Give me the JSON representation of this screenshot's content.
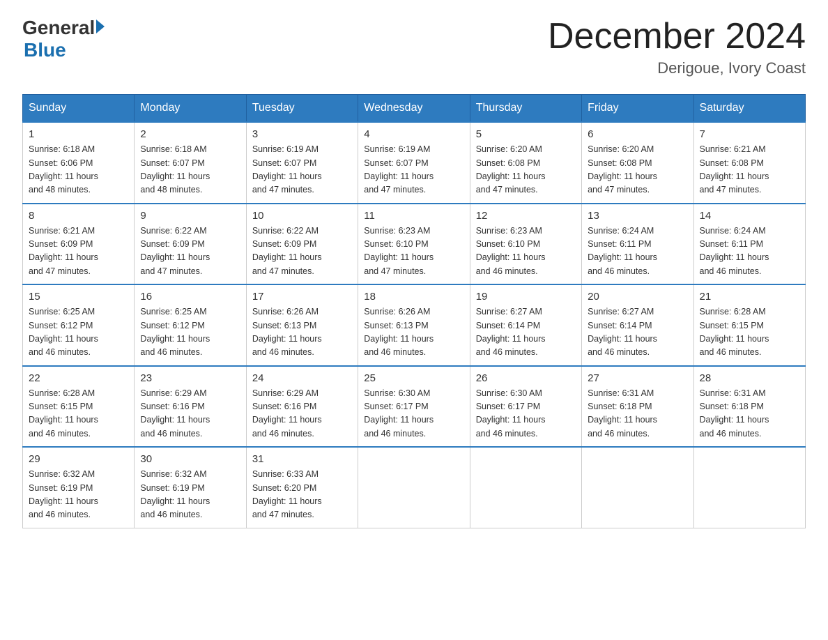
{
  "logo": {
    "general": "General",
    "blue": "Blue"
  },
  "header": {
    "title": "December 2024",
    "location": "Derigoue, Ivory Coast"
  },
  "weekdays": [
    "Sunday",
    "Monday",
    "Tuesday",
    "Wednesday",
    "Thursday",
    "Friday",
    "Saturday"
  ],
  "weeks": [
    [
      {
        "day": "1",
        "sunrise": "6:18 AM",
        "sunset": "6:06 PM",
        "daylight": "11 hours and 48 minutes."
      },
      {
        "day": "2",
        "sunrise": "6:18 AM",
        "sunset": "6:07 PM",
        "daylight": "11 hours and 48 minutes."
      },
      {
        "day": "3",
        "sunrise": "6:19 AM",
        "sunset": "6:07 PM",
        "daylight": "11 hours and 47 minutes."
      },
      {
        "day": "4",
        "sunrise": "6:19 AM",
        "sunset": "6:07 PM",
        "daylight": "11 hours and 47 minutes."
      },
      {
        "day": "5",
        "sunrise": "6:20 AM",
        "sunset": "6:08 PM",
        "daylight": "11 hours and 47 minutes."
      },
      {
        "day": "6",
        "sunrise": "6:20 AM",
        "sunset": "6:08 PM",
        "daylight": "11 hours and 47 minutes."
      },
      {
        "day": "7",
        "sunrise": "6:21 AM",
        "sunset": "6:08 PM",
        "daylight": "11 hours and 47 minutes."
      }
    ],
    [
      {
        "day": "8",
        "sunrise": "6:21 AM",
        "sunset": "6:09 PM",
        "daylight": "11 hours and 47 minutes."
      },
      {
        "day": "9",
        "sunrise": "6:22 AM",
        "sunset": "6:09 PM",
        "daylight": "11 hours and 47 minutes."
      },
      {
        "day": "10",
        "sunrise": "6:22 AM",
        "sunset": "6:09 PM",
        "daylight": "11 hours and 47 minutes."
      },
      {
        "day": "11",
        "sunrise": "6:23 AM",
        "sunset": "6:10 PM",
        "daylight": "11 hours and 47 minutes."
      },
      {
        "day": "12",
        "sunrise": "6:23 AM",
        "sunset": "6:10 PM",
        "daylight": "11 hours and 46 minutes."
      },
      {
        "day": "13",
        "sunrise": "6:24 AM",
        "sunset": "6:11 PM",
        "daylight": "11 hours and 46 minutes."
      },
      {
        "day": "14",
        "sunrise": "6:24 AM",
        "sunset": "6:11 PM",
        "daylight": "11 hours and 46 minutes."
      }
    ],
    [
      {
        "day": "15",
        "sunrise": "6:25 AM",
        "sunset": "6:12 PM",
        "daylight": "11 hours and 46 minutes."
      },
      {
        "day": "16",
        "sunrise": "6:25 AM",
        "sunset": "6:12 PM",
        "daylight": "11 hours and 46 minutes."
      },
      {
        "day": "17",
        "sunrise": "6:26 AM",
        "sunset": "6:13 PM",
        "daylight": "11 hours and 46 minutes."
      },
      {
        "day": "18",
        "sunrise": "6:26 AM",
        "sunset": "6:13 PM",
        "daylight": "11 hours and 46 minutes."
      },
      {
        "day": "19",
        "sunrise": "6:27 AM",
        "sunset": "6:14 PM",
        "daylight": "11 hours and 46 minutes."
      },
      {
        "day": "20",
        "sunrise": "6:27 AM",
        "sunset": "6:14 PM",
        "daylight": "11 hours and 46 minutes."
      },
      {
        "day": "21",
        "sunrise": "6:28 AM",
        "sunset": "6:15 PM",
        "daylight": "11 hours and 46 minutes."
      }
    ],
    [
      {
        "day": "22",
        "sunrise": "6:28 AM",
        "sunset": "6:15 PM",
        "daylight": "11 hours and 46 minutes."
      },
      {
        "day": "23",
        "sunrise": "6:29 AM",
        "sunset": "6:16 PM",
        "daylight": "11 hours and 46 minutes."
      },
      {
        "day": "24",
        "sunrise": "6:29 AM",
        "sunset": "6:16 PM",
        "daylight": "11 hours and 46 minutes."
      },
      {
        "day": "25",
        "sunrise": "6:30 AM",
        "sunset": "6:17 PM",
        "daylight": "11 hours and 46 minutes."
      },
      {
        "day": "26",
        "sunrise": "6:30 AM",
        "sunset": "6:17 PM",
        "daylight": "11 hours and 46 minutes."
      },
      {
        "day": "27",
        "sunrise": "6:31 AM",
        "sunset": "6:18 PM",
        "daylight": "11 hours and 46 minutes."
      },
      {
        "day": "28",
        "sunrise": "6:31 AM",
        "sunset": "6:18 PM",
        "daylight": "11 hours and 46 minutes."
      }
    ],
    [
      {
        "day": "29",
        "sunrise": "6:32 AM",
        "sunset": "6:19 PM",
        "daylight": "11 hours and 46 minutes."
      },
      {
        "day": "30",
        "sunrise": "6:32 AM",
        "sunset": "6:19 PM",
        "daylight": "11 hours and 46 minutes."
      },
      {
        "day": "31",
        "sunrise": "6:33 AM",
        "sunset": "6:20 PM",
        "daylight": "11 hours and 47 minutes."
      },
      null,
      null,
      null,
      null
    ]
  ],
  "labels": {
    "sunrise": "Sunrise:",
    "sunset": "Sunset:",
    "daylight": "Daylight:"
  }
}
